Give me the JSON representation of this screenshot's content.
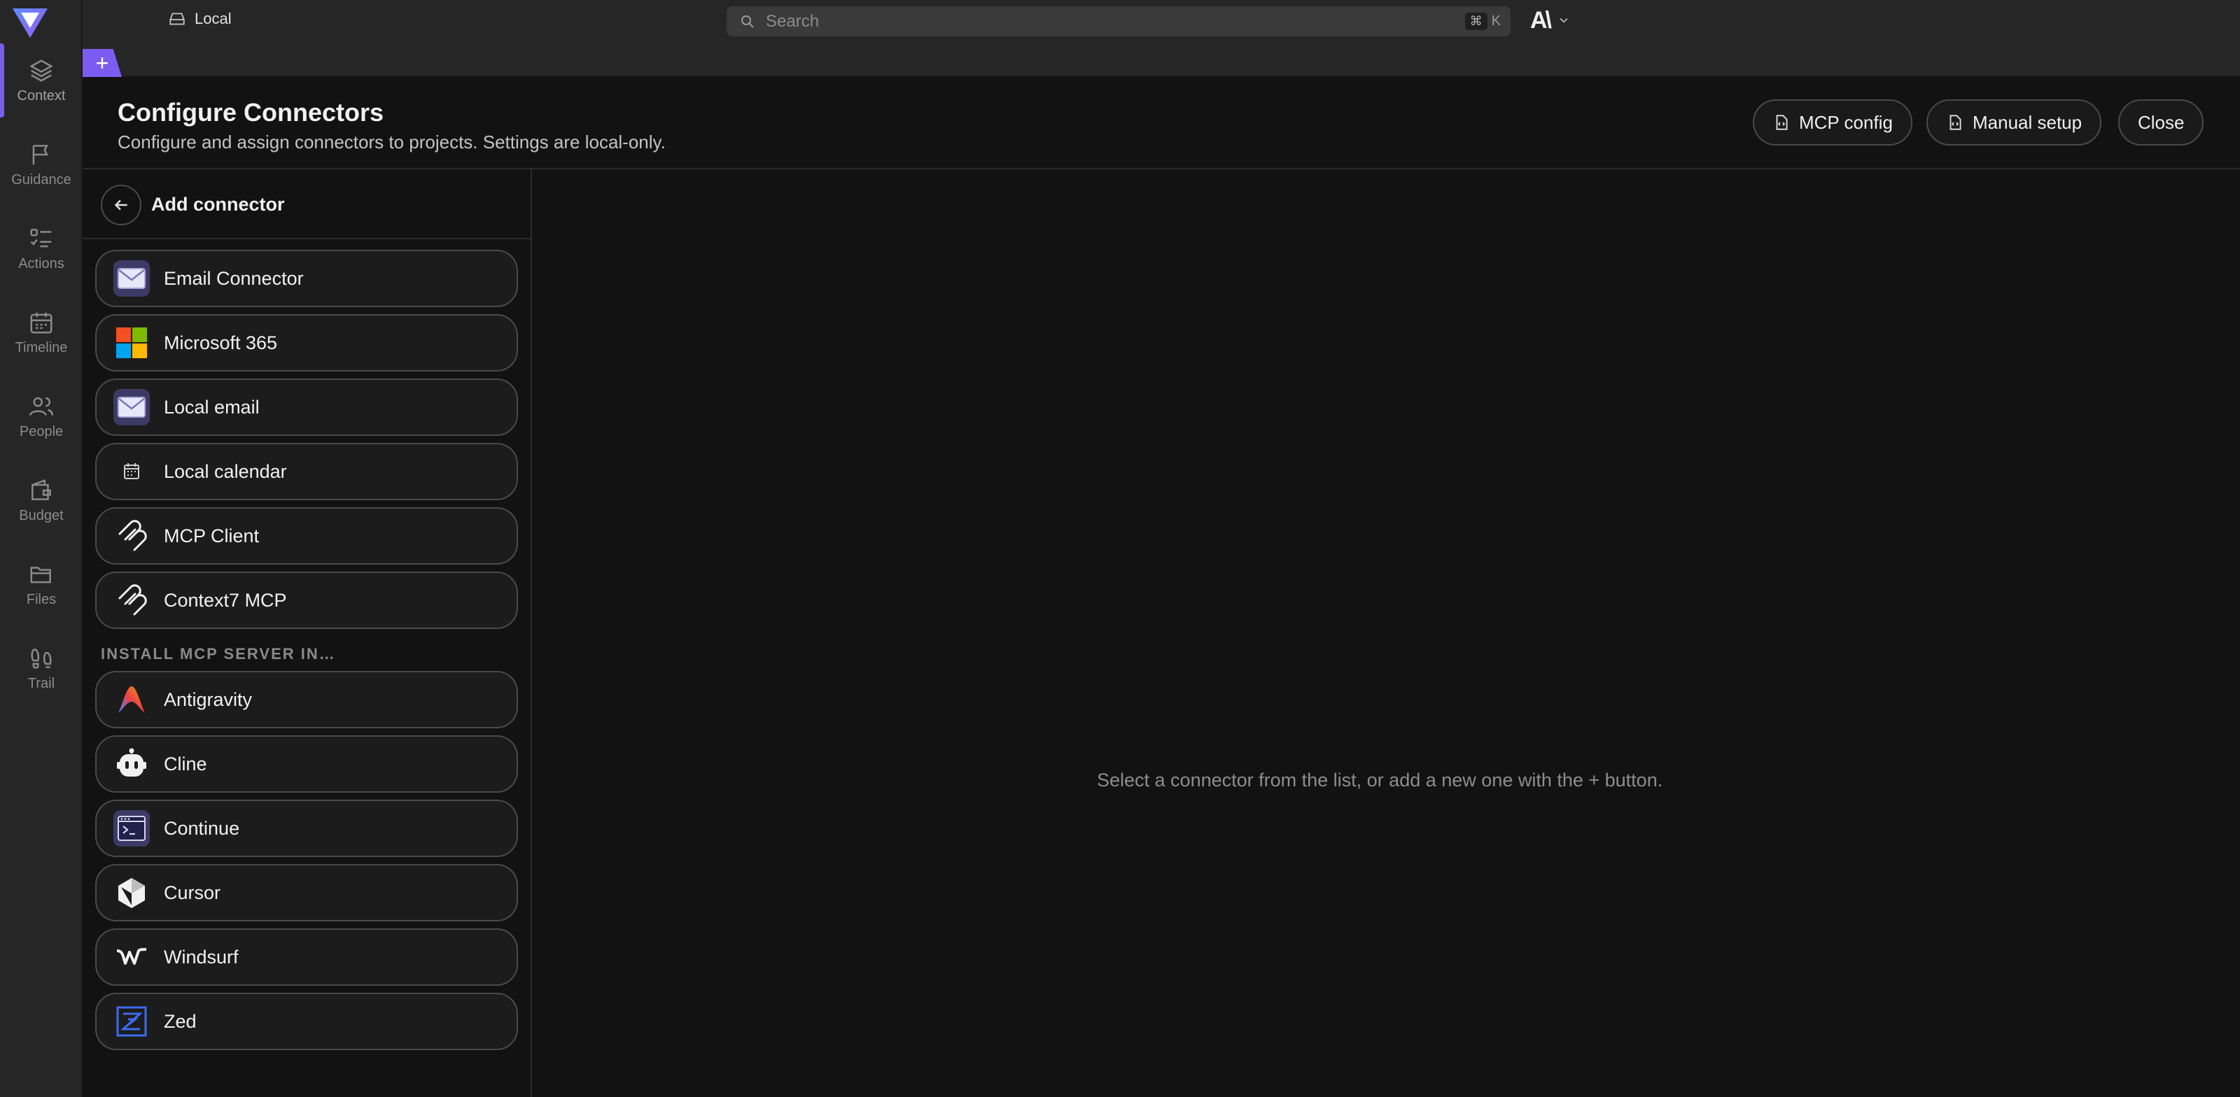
{
  "rail": {
    "items": [
      {
        "label": "Context",
        "icon": "layers-icon"
      },
      {
        "label": "Guidance",
        "icon": "flag-icon"
      },
      {
        "label": "Actions",
        "icon": "list-check-icon"
      },
      {
        "label": "Timeline",
        "icon": "calendar-icon"
      },
      {
        "label": "People",
        "icon": "people-icon"
      },
      {
        "label": "Budget",
        "icon": "wallet-icon"
      },
      {
        "label": "Files",
        "icon": "folder-icon"
      },
      {
        "label": "Trail",
        "icon": "footprints-icon"
      }
    ]
  },
  "topbar": {
    "workspace": "Local",
    "search_placeholder": "Search",
    "shortcut_mod": "⌘",
    "shortcut_key": "K",
    "account_mark": "A\\"
  },
  "tabs": {
    "new_tab": "+"
  },
  "header": {
    "title": "Configure Connectors",
    "subtitle": "Configure and assign connectors to projects. Settings are local-only.",
    "mcp_config": "MCP config",
    "manual_setup": "Manual setup",
    "close": "Close"
  },
  "panel": {
    "title": "Add connector",
    "connectors": [
      {
        "label": "Email Connector",
        "icon": "email-icon"
      },
      {
        "label": "Microsoft 365",
        "icon": "microsoft-icon"
      },
      {
        "label": "Local email",
        "icon": "email-icon"
      },
      {
        "label": "Local calendar",
        "icon": "calendar-icon"
      },
      {
        "label": "MCP Client",
        "icon": "mcp-icon"
      },
      {
        "label": "Context7 MCP",
        "icon": "mcp-icon"
      }
    ],
    "section_label": "INSTALL MCP SERVER IN…",
    "install_targets": [
      {
        "label": "Antigravity",
        "icon": "antigravity-icon"
      },
      {
        "label": "Cline",
        "icon": "cline-icon"
      },
      {
        "label": "Continue",
        "icon": "continue-icon"
      },
      {
        "label": "Cursor",
        "icon": "cursor-icon"
      },
      {
        "label": "Windsurf",
        "icon": "windsurf-icon"
      },
      {
        "label": "Zed",
        "icon": "zed-icon"
      }
    ]
  },
  "main": {
    "placeholder": "Select a connector from the list, or add a new one with the + button."
  },
  "colors": {
    "accent": "#7c5cf0",
    "background": "#121212",
    "chrome": "#262626"
  }
}
